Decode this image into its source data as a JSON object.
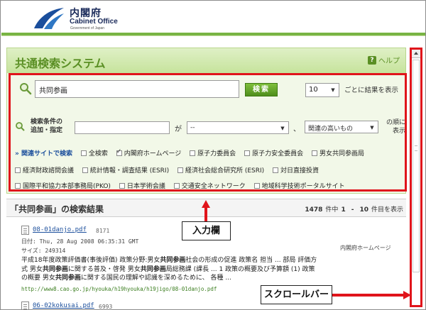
{
  "header": {
    "logo_jp": "内閣府",
    "logo_en": "Cabinet Office",
    "logo_sub": "Government of Japan"
  },
  "app": {
    "title": "共通検索システム",
    "help": "ヘルプ"
  },
  "search": {
    "query": "共同参画",
    "button": "検索",
    "per_page_value": "10",
    "per_page_label": "ごとに結果を表示"
  },
  "conditions": {
    "label_line1": "検索条件の",
    "label_line2": "追加・指定",
    "ga": "が",
    "field_select": "--",
    "comma": "、",
    "sort_select": "関連の高いもの",
    "order_line1": "の順に",
    "order_line2": "表示"
  },
  "related": {
    "heading": "関連サイトで検索",
    "row1": [
      {
        "label": "全検索",
        "checked": false
      },
      {
        "label": "内閣府ホームページ",
        "checked": true
      },
      {
        "label": "原子力委員会",
        "checked": false
      },
      {
        "label": "原子力安全委員会",
        "checked": false
      },
      {
        "label": "男女共同参画局",
        "checked": false
      }
    ],
    "row2": [
      {
        "label": "経済財政諮問会議",
        "checked": false
      },
      {
        "label": "統計情報・調査結果 (ESRI)",
        "checked": false
      },
      {
        "label": "経済社会総合研究所 (ESRI)",
        "checked": false
      },
      {
        "label": "対日直接投資",
        "checked": false
      }
    ],
    "row3": [
      {
        "label": "国際平和協力本部事務局(PKO)",
        "checked": false
      },
      {
        "label": "日本学術会議",
        "checked": false
      },
      {
        "label": "交通安全ネットワーク",
        "checked": false
      },
      {
        "label": "地域科学技術ポータルサイト",
        "checked": false
      }
    ]
  },
  "results": {
    "heading_open": "「",
    "heading_query": "共同参画",
    "heading_close": "」の検索結果",
    "total": "1478",
    "total_suffix": "件中",
    "from": "1",
    "dash": "-",
    "to": "10",
    "range_suffix": "件目を表示",
    "items": [
      {
        "file": "08-01danjo.pdf",
        "size_num": "8171",
        "date": "日付: Thu, 28 Aug 2008 06:35:31 GMT",
        "size": "サイズ: 249314",
        "source": "内閣府ホームページ",
        "snippet_1a": "平成18年度政策評価書(事後評価) 政策分野:男女",
        "snippet_1b": "共同参画",
        "snippet_1c": "社会の形成の促進 政策名 担当 ... 部局 評価方",
        "snippet_2a": "式 男女",
        "snippet_2b": "共同参画",
        "snippet_2c": "に関する普及・啓発 男女",
        "snippet_2d": "共同参画",
        "snippet_2e": "局総務課 (課長 ... 1 政策の概要及び予算額 (1) 政策",
        "snippet_3a": "の概要 男女",
        "snippet_3b": "共同参画",
        "snippet_3c": "に関する国民の理解や認識を深めるために、 各種 ...",
        "url": "http://www8.cao.go.jp/hyouka/h19hyouka/h19jigo/08-01danjo.pdf"
      },
      {
        "file": "06-02kokusai.pdf",
        "size_num": "6993"
      }
    ]
  },
  "callouts": {
    "input_area": "入力欄",
    "scrollbar": "スクロールバー"
  },
  "colors": {
    "accent_green": "#78b443",
    "highlight_red": "#e0141b",
    "link_blue": "#1c4f9c"
  }
}
